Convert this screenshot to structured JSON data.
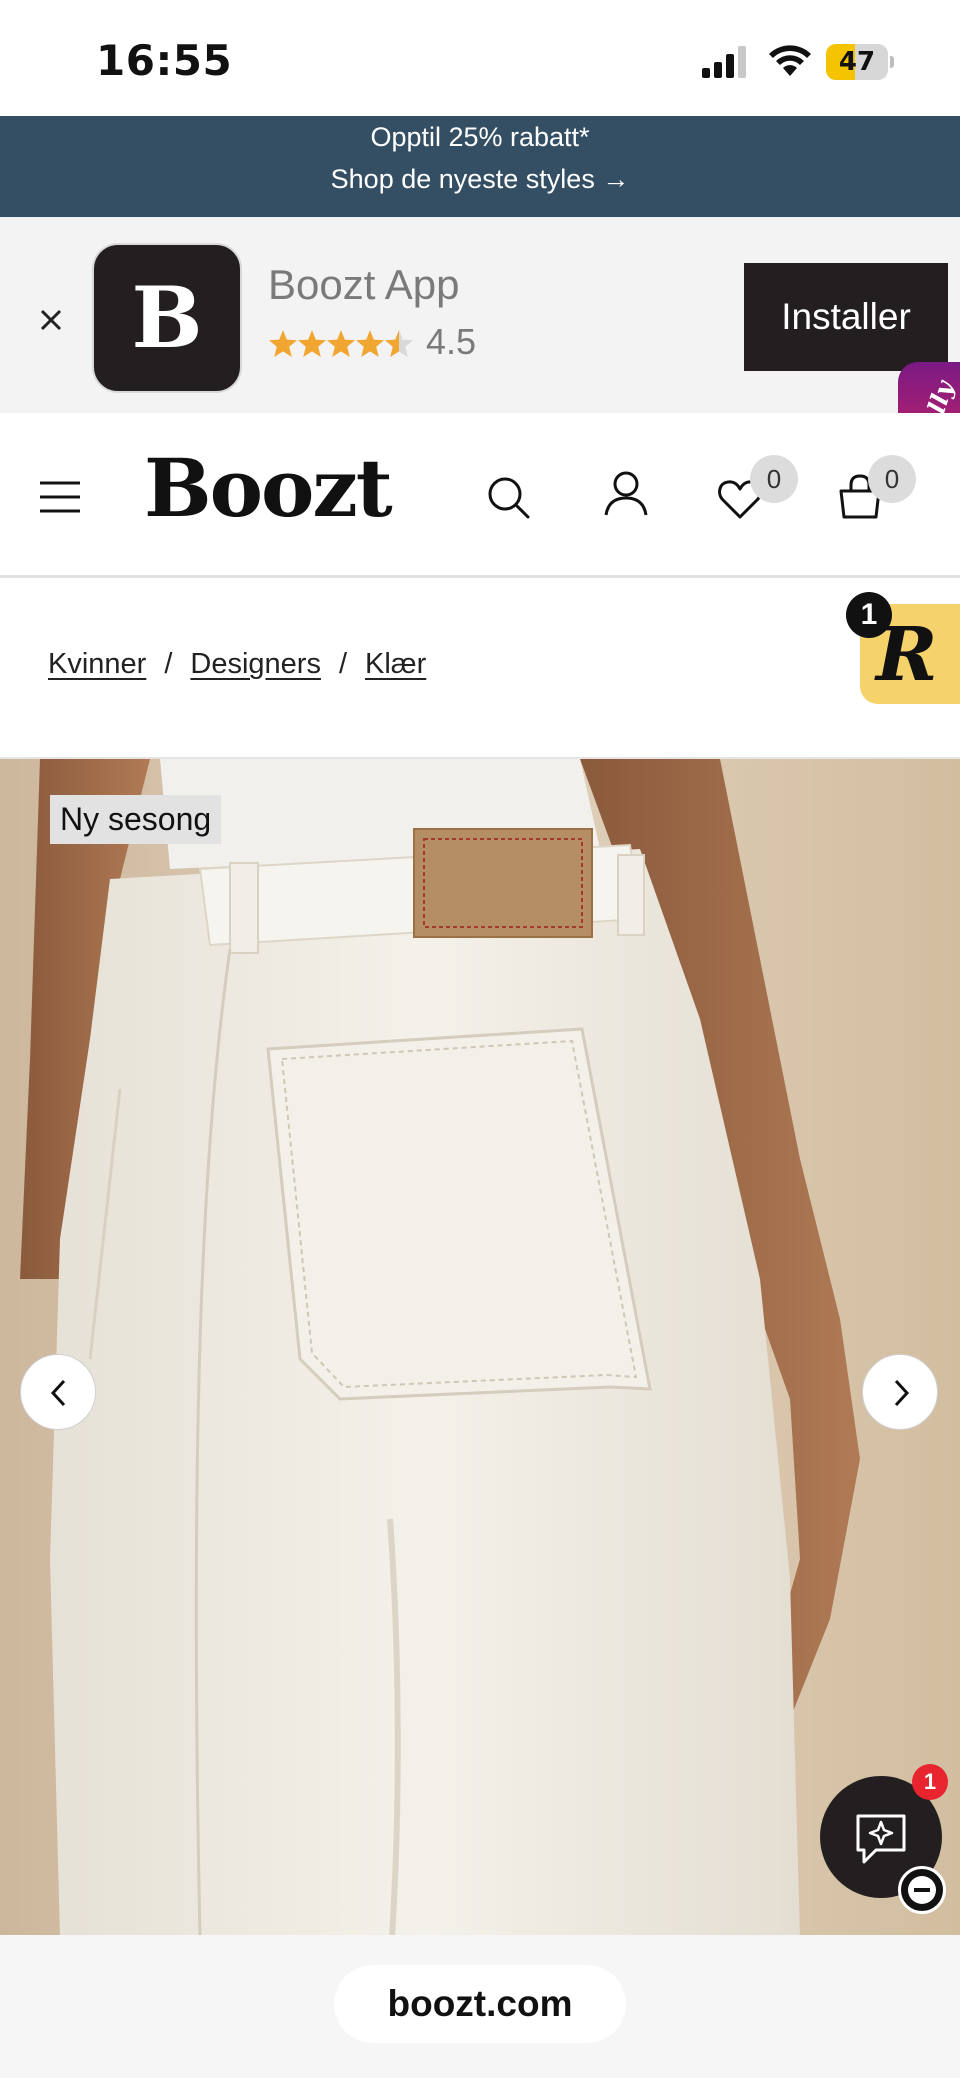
{
  "status_bar": {
    "time": "16:55",
    "battery_level": "47",
    "battery_fraction": 0.47
  },
  "promo": {
    "line1": "Opptil 25% rabatt*",
    "line2": "Shop de nyeste styles →"
  },
  "app_banner": {
    "icon_letter": "B",
    "app_name": "Boozt App",
    "rating": "4.5",
    "install_label": "Installer"
  },
  "molly": {
    "label": "Molly"
  },
  "header": {
    "logo": "Boozt",
    "wishlist_count": "0",
    "cart_count": "0",
    "icons": [
      "menu-icon",
      "search-icon",
      "account-icon",
      "heart-icon",
      "bag-icon"
    ]
  },
  "breadcrumb": {
    "items": [
      "Kvinner",
      "Designers",
      "Klær"
    ],
    "separator": "/"
  },
  "r_widget": {
    "letter": "R",
    "badge": "1"
  },
  "product": {
    "tag": "Ny sesong"
  },
  "chat": {
    "badge": "1"
  },
  "browser": {
    "url": "boozt.com"
  },
  "colors": {
    "promo_bg": "#344e63",
    "banner_bg": "#f3f3f3",
    "dark": "#231f20",
    "star": "#f0a630",
    "r_widget": "#f6d36a",
    "badge_red": "#e8242e"
  }
}
